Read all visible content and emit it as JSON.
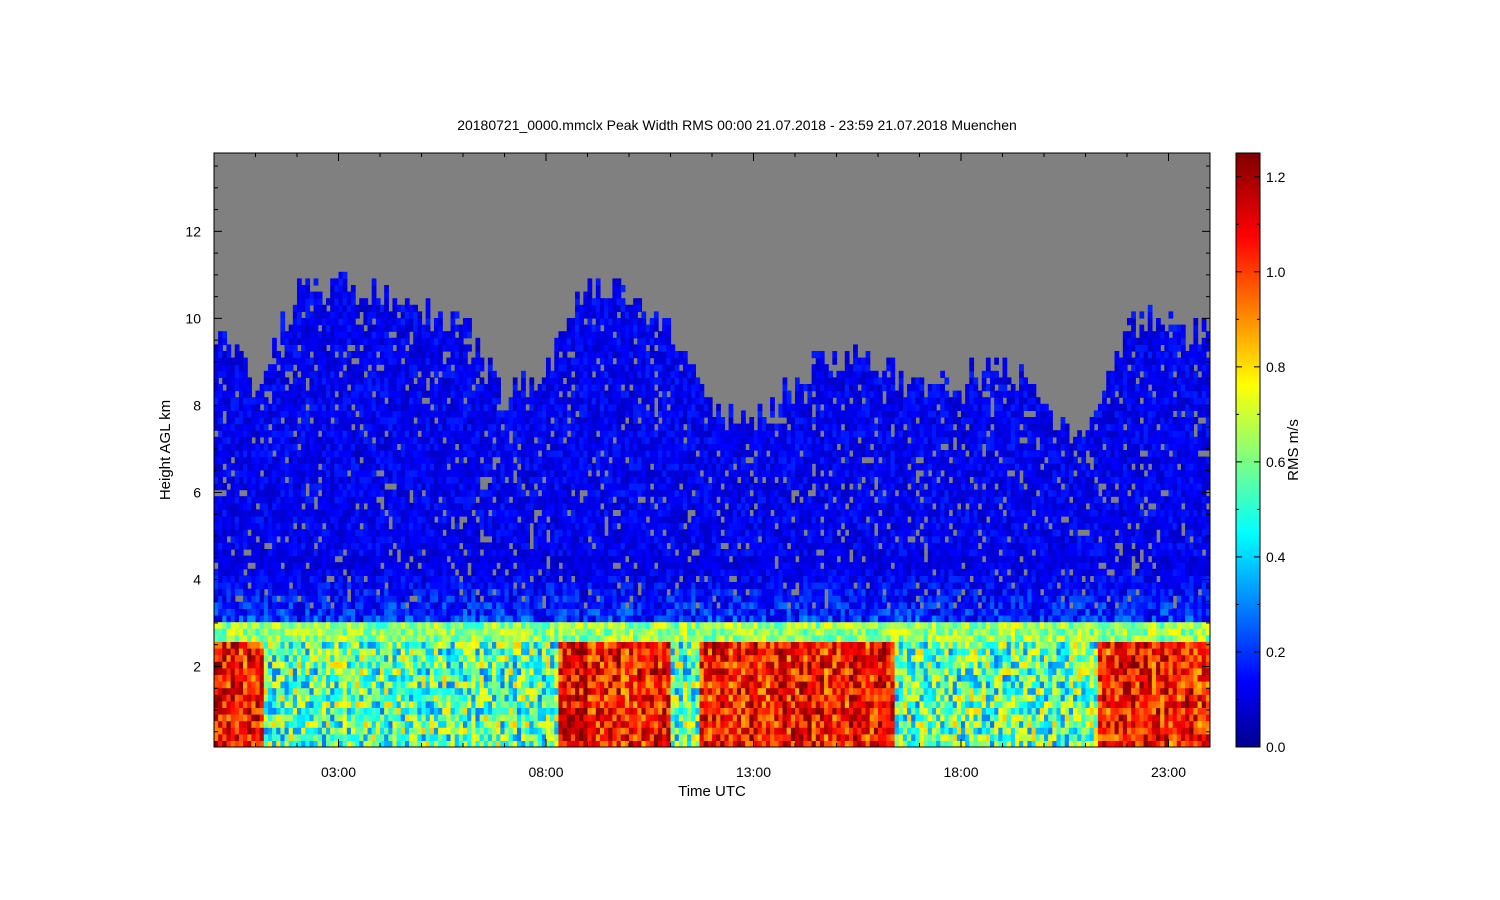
{
  "chart_data": {
    "type": "heatmap",
    "title": "20180721_0000.mmclx Peak Width RMS   00:00 21.07.2018 - 23:59 21.07.2018 Muenchen",
    "xlabel": "Time UTC",
    "ylabel": "Height AGL km",
    "colorbar_label": "RMS m/s",
    "x_ticks": [
      "03:00",
      "08:00",
      "13:00",
      "18:00",
      "23:00"
    ],
    "x_tick_hours": [
      3,
      8,
      13,
      18,
      23
    ],
    "xlim_hours": [
      0,
      24
    ],
    "y_ticks": [
      "2",
      "4",
      "6",
      "8",
      "10",
      "12"
    ],
    "y_tick_values": [
      2,
      4,
      6,
      8,
      10,
      12
    ],
    "ylim": [
      0.15,
      13.8
    ],
    "colorbar_ticks": [
      "0.0",
      "0.2",
      "0.4",
      "0.6",
      "0.8",
      "1.0",
      "1.2"
    ],
    "colorbar_tick_values": [
      0.0,
      0.2,
      0.4,
      0.6,
      0.8,
      1.0,
      1.2
    ],
    "clim": [
      0.0,
      1.25
    ],
    "colormap": "jet",
    "no_data_color": "#808080",
    "cloud_top_km_by_hour": [
      [
        0,
        10.0
      ],
      [
        1,
        8.5
      ],
      [
        2,
        10.6
      ],
      [
        3,
        10.8
      ],
      [
        4,
        10.6
      ],
      [
        5,
        10.2
      ],
      [
        6,
        9.8
      ],
      [
        7,
        8.2
      ],
      [
        8,
        8.8
      ],
      [
        9,
        10.8
      ],
      [
        10,
        10.6
      ],
      [
        11,
        9.8
      ],
      [
        12,
        8.0
      ],
      [
        13,
        7.5
      ],
      [
        14,
        8.5
      ],
      [
        15,
        9.2
      ],
      [
        16,
        9.0
      ],
      [
        17,
        8.4
      ],
      [
        18,
        8.6
      ],
      [
        19,
        9.0
      ],
      [
        20,
        8.0
      ],
      [
        21,
        7.0
      ],
      [
        22,
        9.8
      ],
      [
        23,
        10.0
      ],
      [
        24,
        9.6
      ]
    ],
    "melting_layer_km": 2.8,
    "high_rms_periods_hours": [
      [
        0.0,
        1.2
      ],
      [
        8.3,
        11.0
      ],
      [
        11.7,
        16.4
      ],
      [
        21.3,
        24.0
      ]
    ]
  }
}
